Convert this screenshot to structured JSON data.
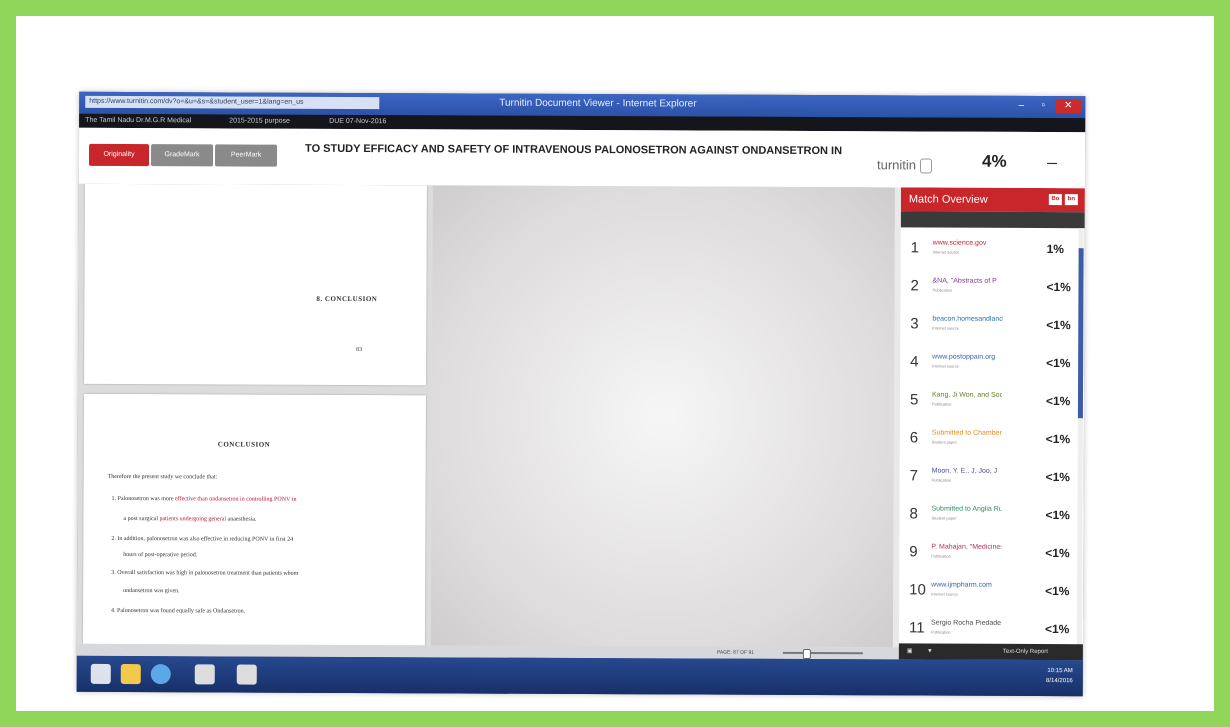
{
  "browser": {
    "window_title": "Turnitin Document Viewer - Internet Explorer",
    "address": "https://www.turnitin.com/dv?o=&u=&s=&student_user=1&lang=en_us",
    "controls": {
      "minimize": "–",
      "maximize": "▫",
      "close": "✕"
    }
  },
  "infobar": {
    "left": "The Tamil Nadu Dr.M.G.R Medical",
    "middle": "2015-2015 purpose",
    "right": "DUE 07-Nov-2016"
  },
  "toolbar": {
    "tabs": [
      "Originality",
      "GradeMark",
      "PeerMark"
    ],
    "document_title": "TO STUDY EFFICACY AND SAFETY OF INTRAVENOUS PALONOSETRON AGAINST ONDANSETRON IN",
    "brand": "turnitin",
    "similarity": "4%",
    "collapse_label": "–"
  },
  "document": {
    "page1": {
      "heading": "8. CONCLUSION",
      "page_no": "83"
    },
    "page2": {
      "heading": "CONCLUSION",
      "intro": "Therefore the present study we conclude that:",
      "points": [
        {
          "n": "1.",
          "pre": "Palonosetron was more",
          "hl": "effective than ondansetron in controlling PONV in"
        },
        {
          "n": "",
          "pre": "a post surgical",
          "hl": "patients undergoing general",
          "post": "anaesthesia."
        },
        {
          "n": "2.",
          "pre": "In addition, palonosetron was also effective in reducing PONV in first 24"
        },
        {
          "n": "",
          "pre": "hours of post-operative period."
        },
        {
          "n": "3.",
          "pre": "Overall satisfaction was high in palonosetron treatment than patients whom"
        },
        {
          "n": "",
          "pre": "ondansetron was given."
        },
        {
          "n": "4.",
          "pre": "Palonosetron was found equally safe as Ondansetron."
        }
      ]
    }
  },
  "match_overview": {
    "title": "Match Overview",
    "buttons": [
      "Bo",
      "bn"
    ],
    "items": [
      {
        "num": "1",
        "source": "www.science.gov",
        "type": "Internet source",
        "pct": "1%",
        "color": "#c8262b"
      },
      {
        "num": "2",
        "source": "&NA, \"Abstracts of P",
        "type": "Publication",
        "pct": "<1%",
        "color": "#7a3b8f"
      },
      {
        "num": "3",
        "source": "beacon.homesandland",
        "type": "Internet source",
        "pct": "<1%",
        "color": "#2f6f9f"
      },
      {
        "num": "4",
        "source": "www.postoppain.org",
        "type": "Internet source",
        "pct": "<1%",
        "color": "#3d5da8"
      },
      {
        "num": "5",
        "source": "Kang, Ji Won, and Soo",
        "type": "Publication",
        "pct": "<1%",
        "color": "#5b7d2a"
      },
      {
        "num": "6",
        "source": "Submitted to Chamber",
        "type": "Student paper",
        "pct": "<1%",
        "color": "#e58b1a"
      },
      {
        "num": "7",
        "source": "Moon, Y. E., J. Joo, J",
        "type": "Publication",
        "pct": "<1%",
        "color": "#4a4a9a"
      },
      {
        "num": "8",
        "source": "Submitted to Anglia Ru",
        "type": "Student paper",
        "pct": "<1%",
        "color": "#2e8b57"
      },
      {
        "num": "9",
        "source": "P. Mahajan, \"Medicines",
        "type": "Publication",
        "pct": "<1%",
        "color": "#b03060"
      },
      {
        "num": "10",
        "source": "www.ijmpharm.com",
        "type": "Internet source",
        "pct": "<1%",
        "color": "#3d5da8"
      },
      {
        "num": "11",
        "source": "Sergio Rocha Piedade",
        "type": "Publication",
        "pct": "<1%",
        "color": "#4a4a4a"
      }
    ]
  },
  "status": {
    "page_info": "PAGE: 87 OF 91",
    "text_only": "Text-Only Report",
    "tray_time": "10:15 AM",
    "tray_date": "8/14/2016"
  }
}
